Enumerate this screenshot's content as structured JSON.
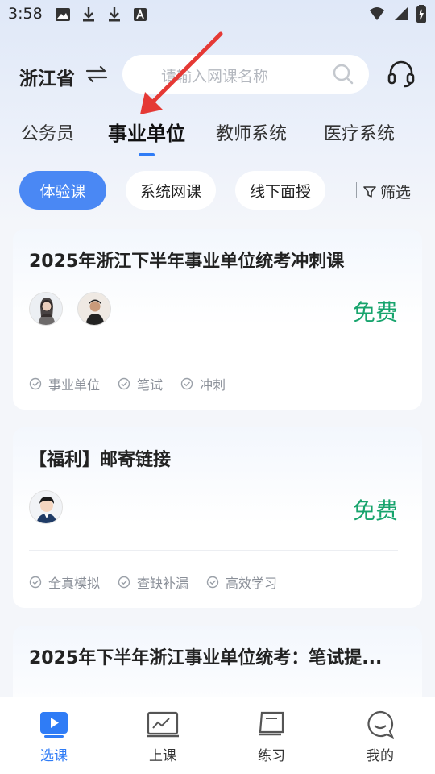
{
  "status": {
    "time": "3:58",
    "left_icons": [
      "image-icon",
      "download-icon",
      "download-icon",
      "font-icon"
    ],
    "right_icons": [
      "wifi-icon",
      "signal-icon",
      "battery-icon"
    ]
  },
  "header": {
    "province": "浙江省",
    "search_placeholder": "请输入网课名称"
  },
  "category_tabs": [
    {
      "label": "公务员",
      "active": false
    },
    {
      "label": "事业单位",
      "active": true
    },
    {
      "label": "教师系统",
      "active": false
    },
    {
      "label": "医疗系统",
      "active": false
    }
  ],
  "filters": {
    "chips": [
      {
        "label": "体验课",
        "active": true
      },
      {
        "label": "系统网课",
        "active": false
      },
      {
        "label": "线下面授",
        "active": false
      }
    ],
    "filter_label": "筛选"
  },
  "courses": [
    {
      "title": "2025年浙江下半年事业单位统考冲刺课",
      "price": "免费",
      "tags": [
        "事业单位",
        "笔试",
        "冲刺"
      ]
    },
    {
      "title": "【福利】邮寄链接",
      "price": "免费",
      "tags": [
        "全真模拟",
        "查缺补漏",
        "高效学习"
      ]
    },
    {
      "title": "2025年下半年浙江事业单位统考：笔试提..."
    }
  ],
  "bottom_nav": [
    {
      "label": "选课",
      "icon": "play-icon",
      "active": true
    },
    {
      "label": "上课",
      "icon": "monitor-icon",
      "active": false
    },
    {
      "label": "练习",
      "icon": "book-icon",
      "active": false
    },
    {
      "label": "我的",
      "icon": "chat-face-icon",
      "active": false
    }
  ],
  "colors": {
    "accent": "#2f7cf6",
    "price_green": "#17a46d",
    "annotation_red": "#e53935"
  }
}
